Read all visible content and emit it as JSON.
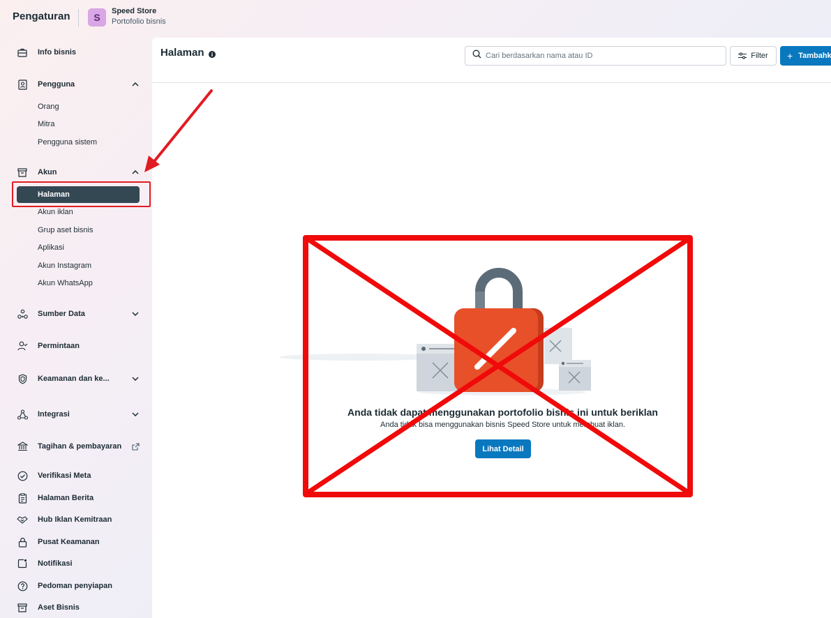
{
  "topbar": {
    "app_title": "Pengaturan",
    "business": {
      "avatar_letter": "S",
      "name": "Speed Store",
      "subtitle": "Portofolio bisnis"
    }
  },
  "sidebar": {
    "info_bisnis": "Info bisnis",
    "pengguna": {
      "label": "Pengguna",
      "items": [
        "Orang",
        "Mitra",
        "Pengguna sistem"
      ]
    },
    "akun": {
      "label": "Akun",
      "active": "Halaman",
      "items": [
        "Akun iklan",
        "Grup aset bisnis",
        "Aplikasi",
        "Akun Instagram",
        "Akun WhatsApp"
      ]
    },
    "sumber_data": "Sumber Data",
    "permintaan": "Permintaan",
    "keamanan": "Keamanan dan ke...",
    "integrasi": "Integrasi",
    "tagihan": "Tagihan & pembayaran",
    "verifikasi": "Verifikasi Meta",
    "halaman_berita": "Halaman Berita",
    "hub_iklan": "Hub Iklan Kemitraan",
    "pusat_keamanan": "Pusat Keamanan",
    "notifikasi": "Notifikasi",
    "pedoman": "Pedoman penyiapan",
    "aset_bisnis": "Aset Bisnis"
  },
  "main": {
    "title": "Halaman",
    "search_placeholder": "Cari berdasarkan nama atau ID",
    "filter_label": "Filter",
    "add_label": "Tambahkan"
  },
  "empty_state": {
    "title": "Anda tidak dapat menggunakan portofolio bisnis ini untuk beriklan",
    "subtitle": "Anda tidak bisa menggunakan bisnis Speed Store untuk membuat iklan.",
    "button": "Lihat Detail"
  },
  "colors": {
    "primary": "#0a78be",
    "active_nav": "#344854",
    "annotation_red": "#e11b22",
    "lock_body": "#e8502a",
    "lock_shackle": "#5c6b78"
  }
}
